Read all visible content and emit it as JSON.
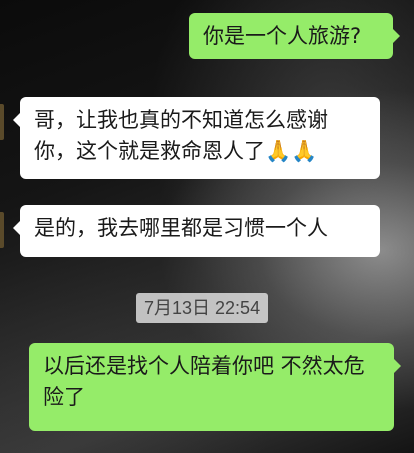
{
  "messages": [
    {
      "direction": "outgoing",
      "text": "你是一个人旅游?"
    },
    {
      "direction": "incoming",
      "text": "哥，让我也真的不知道怎么感谢你，这个就是救命恩人了🙏🙏"
    },
    {
      "direction": "incoming",
      "text": "是的，我去哪里都是习惯一个人"
    },
    {
      "direction": "outgoing",
      "text": "以后还是找个人陪着你吧 不然太危险了"
    }
  ],
  "timestamp": "7月13日 22:54"
}
